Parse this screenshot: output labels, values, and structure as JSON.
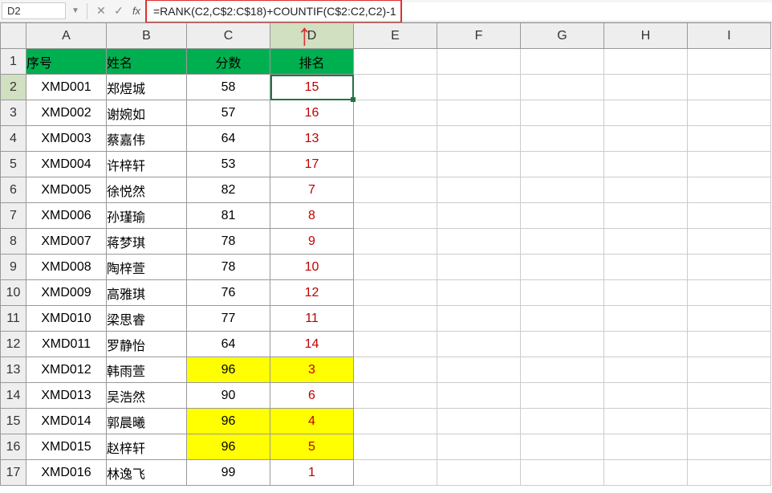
{
  "name_box": "D2",
  "fx_label": "fx",
  "formula": "=RANK(C2,C$2:C$18)+COUNTIF(C$2:C2,C2)-1",
  "columns": [
    "A",
    "B",
    "C",
    "D",
    "E",
    "F",
    "G",
    "H",
    "I"
  ],
  "header_row": {
    "a": "序号",
    "b": "姓名",
    "c": "分数",
    "d": "排名"
  },
  "rows": [
    {
      "a": "XMD001",
      "b": "郑煜城",
      "c": "58",
      "d": "15",
      "hl": false
    },
    {
      "a": "XMD002",
      "b": "谢婉如",
      "c": "57",
      "d": "16",
      "hl": false
    },
    {
      "a": "XMD003",
      "b": "蔡嘉伟",
      "c": "64",
      "d": "13",
      "hl": false
    },
    {
      "a": "XMD004",
      "b": "许梓轩",
      "c": "53",
      "d": "17",
      "hl": false
    },
    {
      "a": "XMD005",
      "b": "徐悦然",
      "c": "82",
      "d": "7",
      "hl": false
    },
    {
      "a": "XMD006",
      "b": "孙瑾瑜",
      "c": "81",
      "d": "8",
      "hl": false
    },
    {
      "a": "XMD007",
      "b": "蒋梦琪",
      "c": "78",
      "d": "9",
      "hl": false
    },
    {
      "a": "XMD008",
      "b": "陶梓萱",
      "c": "78",
      "d": "10",
      "hl": false
    },
    {
      "a": "XMD009",
      "b": "高雅琪",
      "c": "76",
      "d": "12",
      "hl": false
    },
    {
      "a": "XMD010",
      "b": "梁思睿",
      "c": "77",
      "d": "11",
      "hl": false
    },
    {
      "a": "XMD011",
      "b": "罗静怡",
      "c": "64",
      "d": "14",
      "hl": false
    },
    {
      "a": "XMD012",
      "b": "韩雨萱",
      "c": "96",
      "d": "3",
      "hl": true
    },
    {
      "a": "XMD013",
      "b": "吴浩然",
      "c": "90",
      "d": "6",
      "hl": false
    },
    {
      "a": "XMD014",
      "b": "郭晨曦",
      "c": "96",
      "d": "4",
      "hl": true
    },
    {
      "a": "XMD015",
      "b": "赵梓轩",
      "c": "96",
      "d": "5",
      "hl": true
    },
    {
      "a": "XMD016",
      "b": "林逸飞",
      "c": "99",
      "d": "1",
      "hl": false
    }
  ],
  "selected": {
    "row": 2,
    "col": "D"
  },
  "colors": {
    "header": "#00b050",
    "rank": "#c00000",
    "highlight": "#ffff00",
    "annotate": "#e03030"
  }
}
